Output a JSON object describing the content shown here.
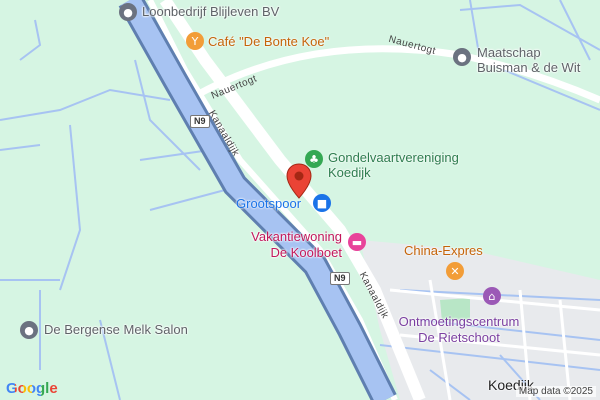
{
  "pois": {
    "loonbedrijf": "Loonbedrijf Blijleven BV",
    "cafe": "Café \"De Bonte Koe\"",
    "maatschap_line1": "Maatschap",
    "maatschap_line2": "Buisman & de Wit",
    "gondel_line1": "Gondelvaartvereniging",
    "gondel_line2": "Koedijk",
    "grootspoor": "Grootspoor",
    "vakantie_line1": "Vakantiewoning",
    "vakantie_line2": "De Koolboet",
    "china": "China-Expres",
    "ontmoeting_line1": "Ontmoetingscentrum",
    "ontmoeting_line2": "De Rietschoot",
    "melk": "De Bergense Melk Salon"
  },
  "roads": {
    "nauertogt_1": "Nauertogt",
    "nauertogt_2": "Nauertogt",
    "kanaaldijk_1": "Kanaaldijk",
    "kanaaldijk_2": "Kanaaldijk",
    "n9_1": "N9",
    "n9_2": "N9"
  },
  "places": {
    "koedijk": "Koedijk"
  },
  "footer": {
    "logo": "Google",
    "attribution": "Map data ©2025"
  },
  "icons": {
    "poi_gray": "map-pin-circle-icon",
    "cafe": "cocktail-icon",
    "park": "tree-icon",
    "shop": "shopping-bag-icon",
    "hotel": "bed-icon",
    "restaurant": "fork-knife-icon",
    "community": "community-center-icon",
    "marker": "red-location-marker-icon"
  },
  "colors": {
    "land": "#d6f5e3",
    "water": "#a7c3f2",
    "canal_border": "#5f7fb0",
    "road": "#ffffff",
    "urban": "#e8eaed"
  }
}
